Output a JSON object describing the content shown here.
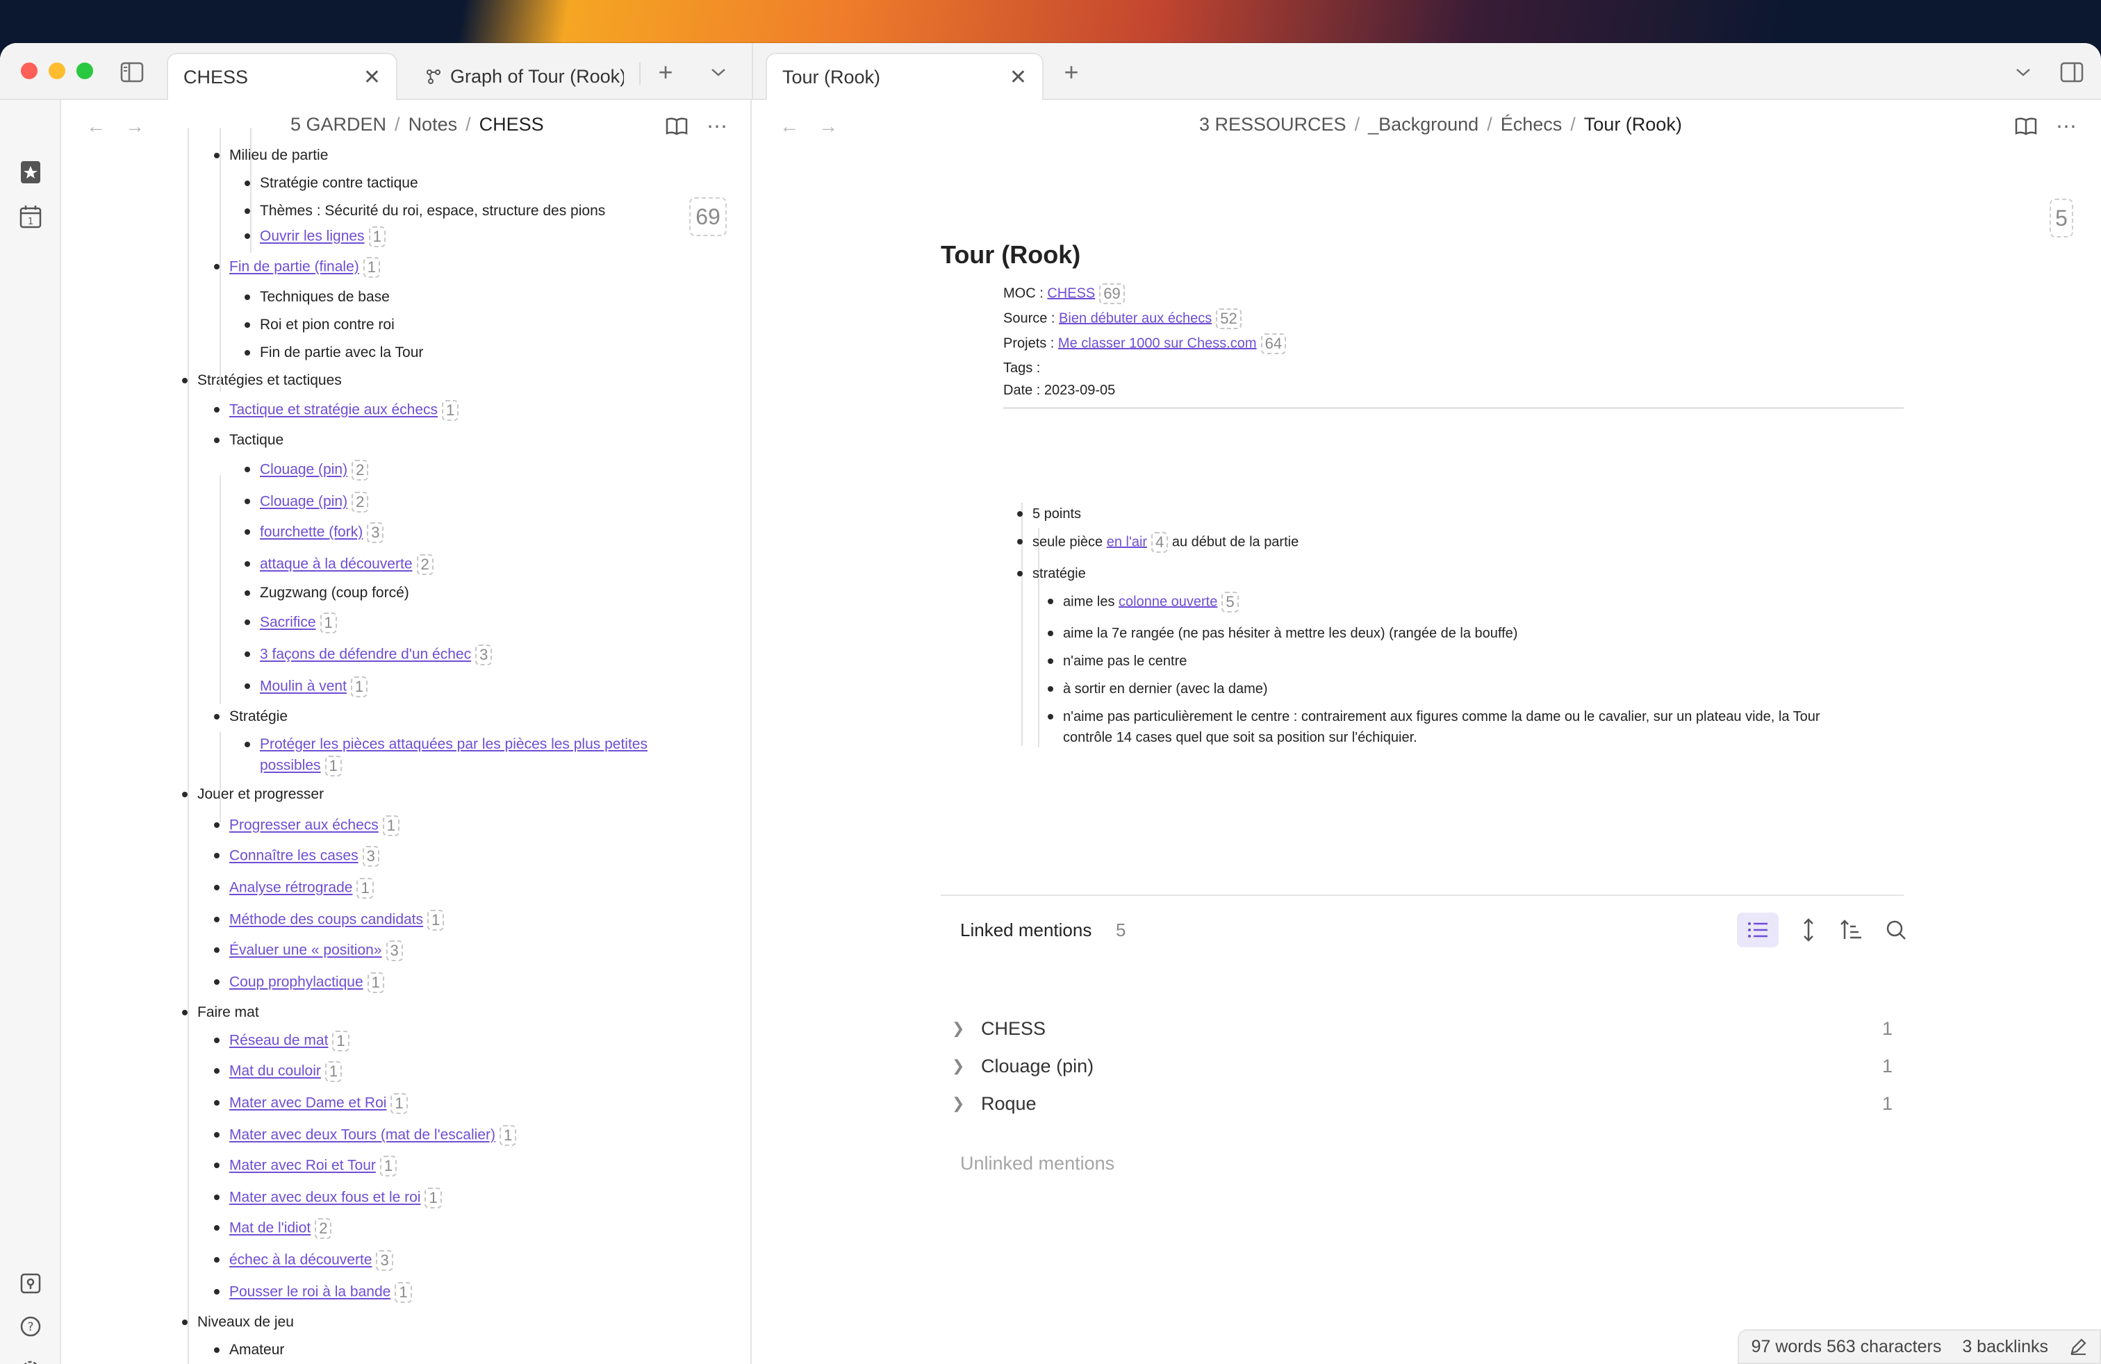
{
  "colors": {
    "accent": "#6e4ed3",
    "wallpaper_orange": "#f5a623"
  },
  "tabs": {
    "left": [
      {
        "label": "CHESS",
        "active": true
      },
      {
        "label": "Graph of Tour (Rook)",
        "active": false
      }
    ],
    "right": [
      {
        "label": "Tour (Rook)",
        "active": true
      }
    ]
  },
  "left_pane": {
    "breadcrumb": [
      "5 GARDEN",
      "Notes",
      "CHESS"
    ],
    "count": "69",
    "lines": [
      {
        "text": "Milieu de partie",
        "level": 1,
        "link": false
      },
      {
        "text": "Stratégie contre tactique",
        "level": 2,
        "link": false
      },
      {
        "text": "Thèmes : Sécurité du roi, espace, structure des pions",
        "level": 2,
        "link": false
      },
      {
        "text": "Ouvrir les lignes",
        "level": 2,
        "link": true,
        "count": "1"
      },
      {
        "text": "Fin de partie (finale)",
        "level": 1,
        "link": true,
        "count": "1"
      },
      {
        "text": "Techniques de base",
        "level": 2,
        "link": false
      },
      {
        "text": "Roi et pion contre roi",
        "level": 2,
        "link": false
      },
      {
        "text": "Fin de partie avec la Tour",
        "level": 2,
        "link": false
      },
      {
        "text": "Stratégies et tactiques",
        "level": 0,
        "link": false
      },
      {
        "text": "Tactique et stratégie aux échecs",
        "level": 1,
        "link": true,
        "count": "1"
      },
      {
        "text": "Tactique",
        "level": 1,
        "link": false
      },
      {
        "text": "Clouage (pin)",
        "level": 2,
        "link": true,
        "count": "2"
      },
      {
        "text": "Clouage (pin)",
        "level": 2,
        "link": true,
        "count": "2"
      },
      {
        "text": "fourchette (fork)",
        "level": 2,
        "link": true,
        "count": "3"
      },
      {
        "text": "attaque à la découverte",
        "level": 2,
        "link": true,
        "count": "2"
      },
      {
        "text": "Zugzwang  (coup forcé)",
        "level": 2,
        "link": false
      },
      {
        "text": "Sacrifice",
        "level": 2,
        "link": true,
        "count": "1"
      },
      {
        "text": "3 façons de défendre d'un échec",
        "level": 2,
        "link": true,
        "count": "3"
      },
      {
        "text": "Moulin à vent",
        "level": 2,
        "link": true,
        "count": "1"
      },
      {
        "text": "Stratégie",
        "level": 1,
        "link": false
      },
      {
        "text": "Protéger les pièces attaquées par les pièces les plus petites",
        "level": 2,
        "link": true
      },
      {
        "text": "possibles",
        "level": 2,
        "link": true,
        "count": "1",
        "continuation": true
      },
      {
        "text": "Jouer et progresser",
        "level": 0,
        "link": false
      },
      {
        "text": "Progresser aux échecs",
        "level": 1,
        "link": true,
        "count": "1"
      },
      {
        "text": "Connaître les cases",
        "level": 1,
        "link": true,
        "count": "3"
      },
      {
        "text": "Analyse rétrograde",
        "level": 1,
        "link": true,
        "count": "1"
      },
      {
        "text": "Méthode des coups candidats",
        "level": 1,
        "link": true,
        "count": "1"
      },
      {
        "text": "Évaluer une « position»",
        "level": 1,
        "link": true,
        "count": "3"
      },
      {
        "text": "Coup prophylactique",
        "level": 1,
        "link": true,
        "count": "1"
      },
      {
        "text": "Faire mat",
        "level": 0,
        "link": false
      },
      {
        "text": "Réseau de mat",
        "level": 1,
        "link": true,
        "count": "1"
      },
      {
        "text": "Mat du couloir",
        "level": 1,
        "link": true,
        "count": "1"
      },
      {
        "text": "Mater avec Dame et Roi",
        "level": 1,
        "link": true,
        "count": "1"
      },
      {
        "text": "Mater avec deux Tours (mat de l'escalier)",
        "level": 1,
        "link": true,
        "count": "1"
      },
      {
        "text": "Mater avec Roi et Tour",
        "level": 1,
        "link": true,
        "count": "1"
      },
      {
        "text": "Mater avec deux fous et le roi",
        "level": 1,
        "link": true,
        "count": "1"
      },
      {
        "text": "Mat de l'idiot",
        "level": 1,
        "link": true,
        "count": "2"
      },
      {
        "text": "échec à la découverte",
        "level": 1,
        "link": true,
        "count": "3"
      },
      {
        "text": "Pousser le roi à la bande",
        "level": 1,
        "link": true,
        "count": "1"
      },
      {
        "text": "Niveaux de jeu",
        "level": 0,
        "link": false
      },
      {
        "text": "Amateur",
        "level": 1,
        "link": false
      }
    ]
  },
  "right_pane": {
    "breadcrumb": [
      "3 RESSOURCES",
      "_Background",
      "Échecs",
      "Tour (Rook)"
    ],
    "count": "5",
    "title": "Tour (Rook)",
    "props": {
      "moc_label": "MOC : ",
      "moc_link": "CHESS",
      "moc_count": "69",
      "source_label": "Source : ",
      "source_link": "Bien débuter aux échecs",
      "source_count": "52",
      "projets_label": "Projets : ",
      "projets_link": "Me classer 1000 sur Chess.com",
      "projets_count": "64",
      "tags_label": "Tags :",
      "date_label": "Date : 2023-09-05"
    },
    "body": {
      "l1": "5 points",
      "l2_pre": "seule pièce ",
      "l2_link": "en l'air",
      "l2_count": "4",
      "l2_post": " au début de la partie",
      "l3": "stratégie",
      "l4_pre": "aime les ",
      "l4_link": "colonne ouverte",
      "l4_count": "5",
      "l5": "aime la 7e rangée (ne pas hésiter à mettre les deux) (rangée de la bouffe)",
      "l6": "n'aime pas le centre",
      "l7": "à sortir en dernier (avec la dame)",
      "l8a": "n'aime pas particulièrement le centre : contrairement aux figures comme la dame ou le cavalier, sur un plateau vide, la Tour",
      "l8b": "contrôle 14 cases quel que soit sa position sur l'échiquier."
    },
    "linked_mentions": {
      "title": "Linked mentions",
      "count": "5",
      "items": [
        {
          "label": "CHESS",
          "count": "1"
        },
        {
          "label": "Clouage (pin)",
          "count": "1"
        },
        {
          "label": "Roque",
          "count": "1"
        }
      ]
    },
    "unlinked_title": "Unlinked mentions"
  },
  "status": {
    "words": "97 words 563 characters",
    "backlinks": "3 backlinks"
  }
}
